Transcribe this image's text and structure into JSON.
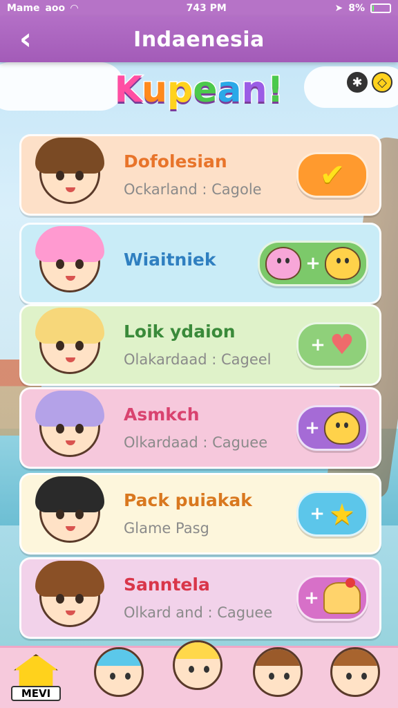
{
  "status_bar": {
    "carrier": "Mame",
    "network": "aoo",
    "time": "743 PM",
    "battery": "8%"
  },
  "header": {
    "back_icon": "chevron-left-icon",
    "title": "Indaenesia"
  },
  "logo": {
    "letters": [
      "K",
      "u",
      "p",
      "e",
      "a",
      "n",
      "!"
    ]
  },
  "top_icons": [
    "gear-icon",
    "swap-icon"
  ],
  "cards": [
    {
      "title": "Dofolesian",
      "subtitle": "Ockarland : Cagole",
      "title_color": "#e8742a",
      "bg": "#fde0c8",
      "action": "check",
      "action_bg": "#ff9a2e"
    },
    {
      "title": "Wiaitniek",
      "subtitle": "",
      "title_color": "#2f7fc0",
      "bg": "#c9ecf7",
      "action": "pets",
      "action_bg": "#7cc96a"
    },
    {
      "title": "Loik ydaion",
      "subtitle": "Olakardaad : Cageel",
      "title_color": "#3a8a3a",
      "bg": "#dff2c9",
      "action": "heart",
      "action_bg": "#8fd07a"
    },
    {
      "title": "Asmkch",
      "subtitle": "Olkardaad : Caguee",
      "title_color": "#d9436f",
      "bg": "#f6c8dc",
      "action": "bear",
      "action_bg": "#a56bd6"
    },
    {
      "title": "Pack puiakak",
      "subtitle": "Glame Pasg",
      "title_color": "#d9781f",
      "bg": "#fdf6dc",
      "action": "star",
      "action_bg": "#5cc6ea"
    },
    {
      "title": "Sanntela",
      "subtitle": "Olkard and : Caguee",
      "title_color": "#d9364a",
      "bg": "#f2d2ea",
      "action": "pudding",
      "action_bg": "#d770c8"
    }
  ],
  "bottom_nav": {
    "home_label": "MEVI"
  }
}
